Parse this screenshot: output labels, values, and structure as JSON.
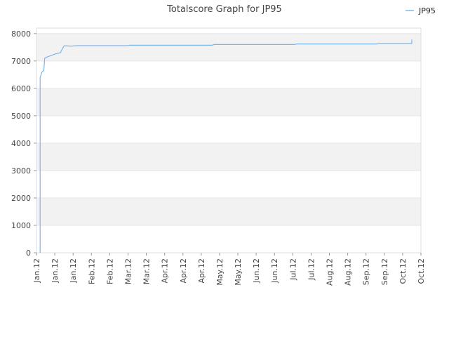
{
  "chart_data": {
    "type": "line",
    "title": "Totalscore Graph for JP95",
    "xlabel": "",
    "ylabel": "",
    "ylim": [
      0,
      8200
    ],
    "y_ticks": [
      0,
      1000,
      2000,
      3000,
      4000,
      5000,
      6000,
      7000,
      8000
    ],
    "x_tick_labels": [
      "Jan.12",
      "Jan.12",
      "Jan.12",
      "Feb.12",
      "Feb.12",
      "Mar.12",
      "Mar.12",
      "Apr.12",
      "Apr.12",
      "Apr.12",
      "May.12",
      "May.12",
      "Jun.12",
      "Jun.12",
      "Jul.12",
      "Jul.12",
      "Aug.12",
      "Aug.12",
      "Sep.12",
      "Sep.12",
      "Oct.12",
      "Oct.12"
    ],
    "grid": true,
    "band_colors": [
      "#f2f2f2",
      "#ffffff"
    ],
    "legend": {
      "position": "top-right"
    },
    "series": [
      {
        "name": "JP95",
        "color": "#7cb5ec",
        "points": [
          [
            0.2,
            0
          ],
          [
            0.2,
            6400
          ],
          [
            0.3,
            6600
          ],
          [
            0.4,
            6650
          ],
          [
            0.45,
            7100
          ],
          [
            0.6,
            7150
          ],
          [
            0.8,
            7200
          ],
          [
            1.0,
            7250
          ],
          [
            1.3,
            7300
          ],
          [
            1.5,
            7550
          ],
          [
            1.7,
            7550
          ],
          [
            1.9,
            7540
          ],
          [
            2.2,
            7560
          ],
          [
            5.0,
            7560
          ],
          [
            5.1,
            7575
          ],
          [
            9.6,
            7575
          ],
          [
            9.7,
            7600
          ],
          [
            14.1,
            7600
          ],
          [
            14.2,
            7620
          ],
          [
            18.6,
            7620
          ],
          [
            18.7,
            7640
          ],
          [
            20.5,
            7640
          ],
          [
            20.5,
            7780
          ]
        ]
      }
    ]
  }
}
